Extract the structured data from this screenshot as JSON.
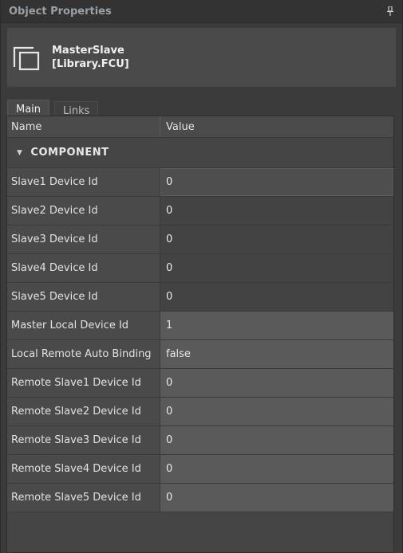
{
  "panel": {
    "title": "Object Properties"
  },
  "object": {
    "name": "MasterSlave",
    "type": "[Library.FCU]"
  },
  "tabs": [
    {
      "label": "Main",
      "active": true
    },
    {
      "label": "Links",
      "active": false
    }
  ],
  "grid": {
    "headers": {
      "name": "Name",
      "value": "Value"
    },
    "section": {
      "label": "COMPONENT",
      "expanded": true
    },
    "rows": [
      {
        "name": "Slave1 Device Id",
        "value": "0"
      },
      {
        "name": "Slave2 Device Id",
        "value": "0"
      },
      {
        "name": "Slave3 Device Id",
        "value": "0"
      },
      {
        "name": "Slave4 Device Id",
        "value": "0"
      },
      {
        "name": "Slave5 Device Id",
        "value": "0"
      },
      {
        "name": "Master Local Device Id",
        "value": "1"
      },
      {
        "name": "Local Remote Auto Binding",
        "value": "false"
      },
      {
        "name": "Remote Slave1 Device Id",
        "value": "0"
      },
      {
        "name": "Remote Slave2 Device Id",
        "value": "0"
      },
      {
        "name": "Remote Slave3 Device Id",
        "value": "0"
      },
      {
        "name": "Remote Slave4 Device Id",
        "value": "0"
      },
      {
        "name": "Remote Slave5 Device Id",
        "value": "0"
      }
    ]
  },
  "icons": {
    "pin": "pin-icon",
    "object": "object-icon",
    "caret": "caret-down-icon"
  },
  "colors": {
    "background": "#3b3b3b",
    "header": "#4a4a4a",
    "value_highlight": "#5a5a5a"
  }
}
